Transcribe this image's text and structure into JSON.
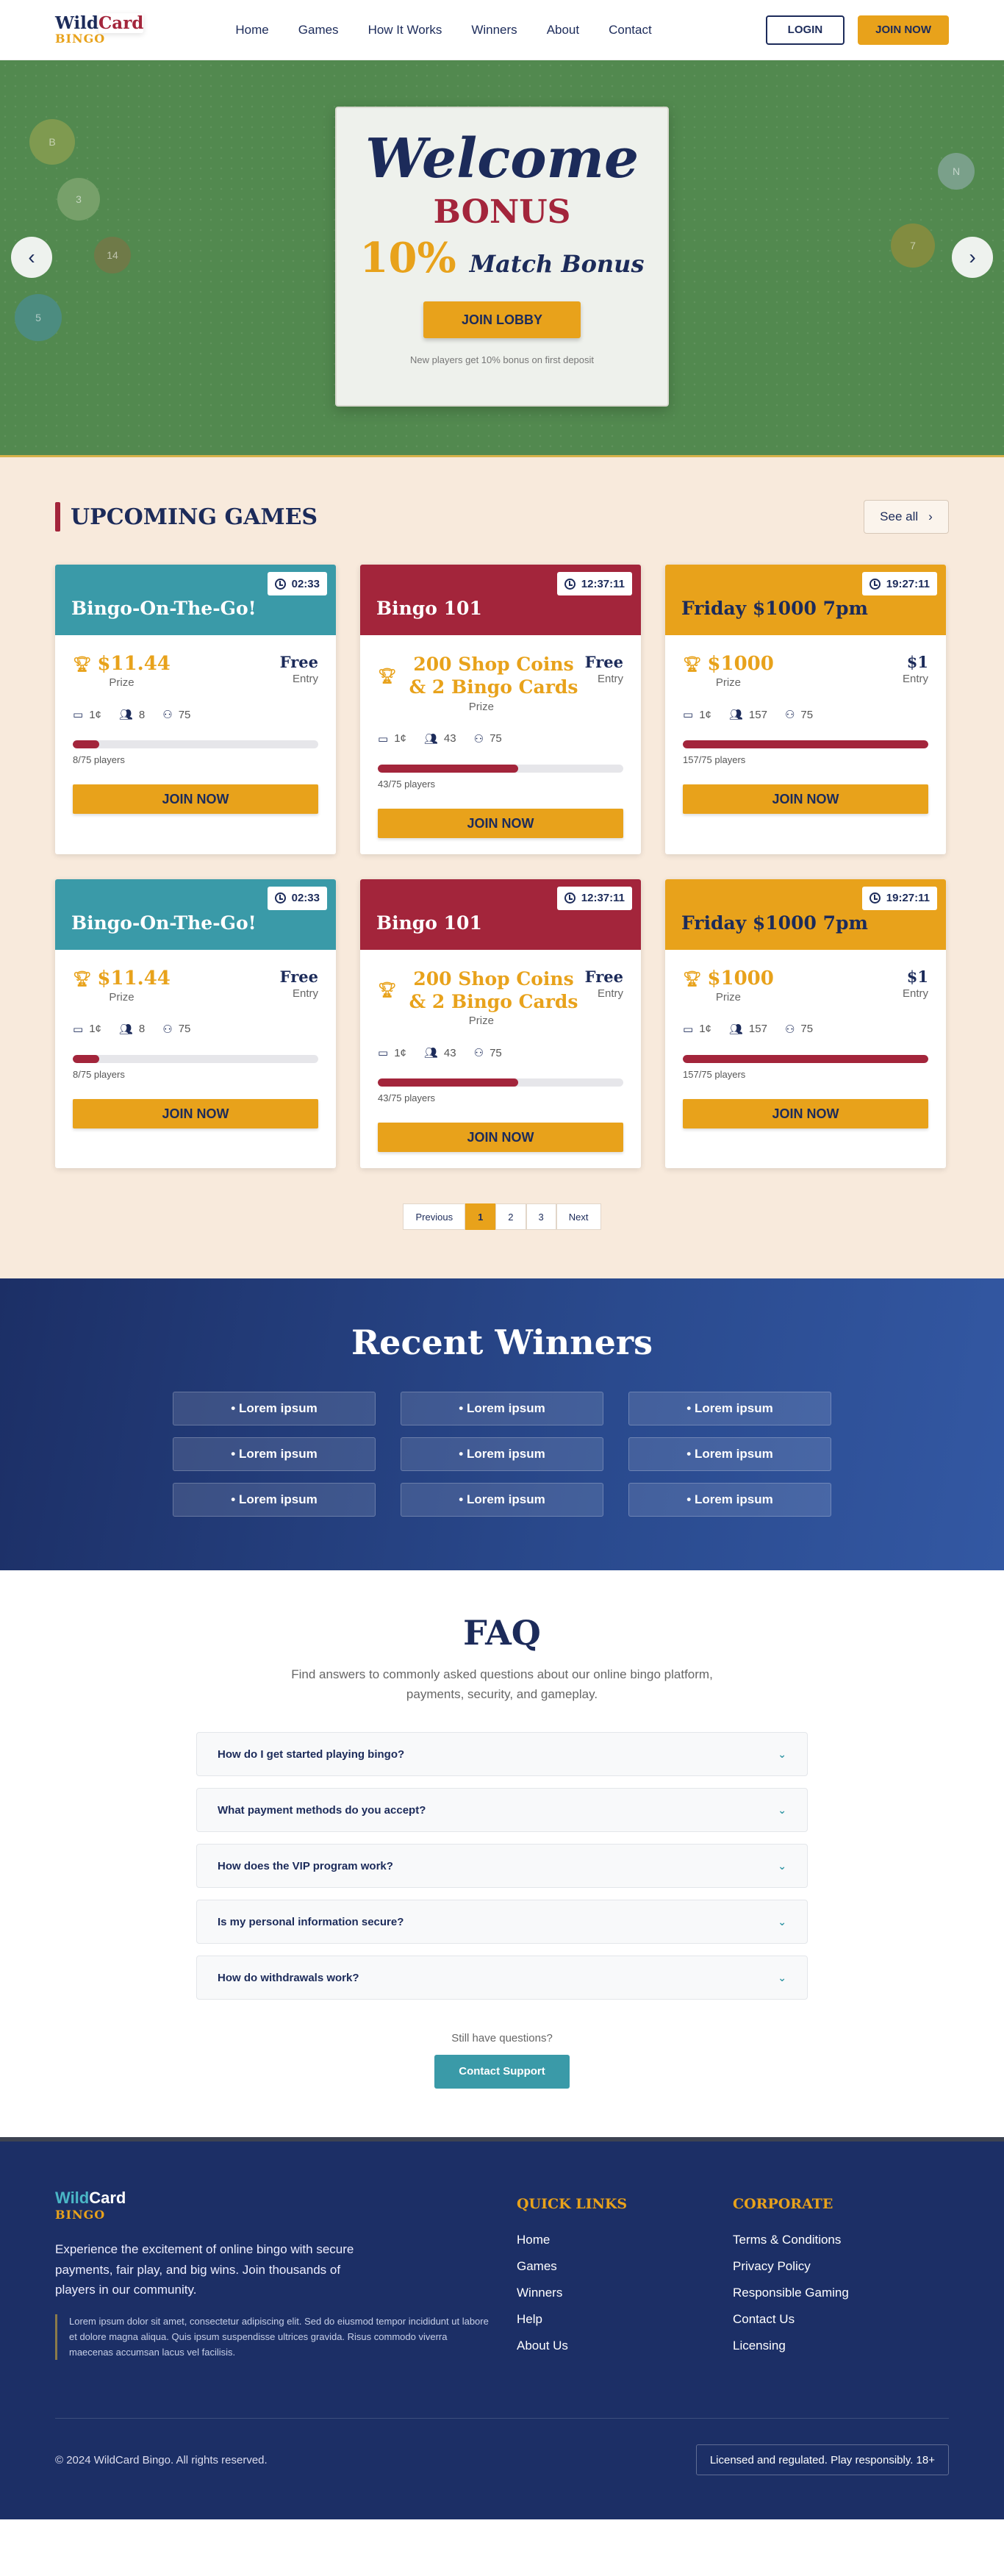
{
  "brand": {
    "line1a": "Wild",
    "line1b": "Card",
    "line2": "BINGO"
  },
  "nav": [
    "Home",
    "Games",
    "How It Works",
    "Winners",
    "About",
    "Contact"
  ],
  "header_buttons": {
    "login": "LOGIN",
    "join": "JOIN NOW"
  },
  "hero": {
    "welcome": "Welcome",
    "bonus": "BONUS",
    "percent": "10%",
    "match": "Match Bonus",
    "cta": "JOIN LOBBY",
    "note": "New players get 10% bonus on first deposit",
    "balls": [
      "B",
      "3",
      "14",
      "5",
      "N",
      "7"
    ],
    "prev_icon": "chevron-left-icon",
    "next_icon": "chevron-right-icon"
  },
  "upcoming": {
    "title": "UPCOMING GAMES",
    "see_all": "See all",
    "prize_label": "Prize",
    "entry_label": "Entry",
    "join_label": "JOIN NOW",
    "games": [
      {
        "title": "Bingo-On-The-Go!",
        "timer": "02:33",
        "color": "#3a9aa8",
        "prize": "$11.44",
        "entry": "Free",
        "card_price": "1¢",
        "players_now": "8",
        "max": "75",
        "players_text": "8/75 players",
        "progress": 0.107
      },
      {
        "title": "Bingo 101",
        "timer": "12:37:11",
        "color": "#a3253b",
        "prize": "200 Shop Coins & 2 Bingo Cards",
        "entry": "Free",
        "card_price": "1¢",
        "players_now": "43",
        "max": "75",
        "players_text": "43/75 players",
        "progress": 0.573
      },
      {
        "title": "Friday $1000 7pm",
        "timer": "19:27:11",
        "color": "#e8a21b",
        "prize": "$1000",
        "entry": "$1",
        "card_price": "1¢",
        "players_now": "157",
        "max": "75",
        "players_text": "157/75 players",
        "progress": 1.0
      },
      {
        "title": "Bingo-On-The-Go!",
        "timer": "02:33",
        "color": "#3a9aa8",
        "prize": "$11.44",
        "entry": "Free",
        "card_price": "1¢",
        "players_now": "8",
        "max": "75",
        "players_text": "8/75 players",
        "progress": 0.107
      },
      {
        "title": "Bingo 101",
        "timer": "12:37:11",
        "color": "#a3253b",
        "prize": "200 Shop Coins & 2 Bingo Cards",
        "entry": "Free",
        "card_price": "1¢",
        "players_now": "43",
        "max": "75",
        "players_text": "43/75 players",
        "progress": 0.573
      },
      {
        "title": "Friday $1000 7pm",
        "timer": "19:27:11",
        "color": "#e8a21b",
        "prize": "$1000",
        "entry": "$1",
        "card_price": "1¢",
        "players_now": "157",
        "max": "75",
        "players_text": "157/75 players",
        "progress": 1.0
      }
    ],
    "pagination": {
      "prev": "Previous",
      "pages": [
        "1",
        "2",
        "3"
      ],
      "active": "1",
      "next": "Next"
    }
  },
  "winners": {
    "title": "Recent Winners",
    "items": [
      "• Lorem ipsum",
      "• Lorem ipsum",
      "• Lorem ipsum",
      "• Lorem ipsum",
      "• Lorem ipsum",
      "• Lorem ipsum",
      "• Lorem ipsum",
      "• Lorem ipsum",
      "• Lorem ipsum"
    ]
  },
  "faq": {
    "title": "FAQ",
    "subtitle": "Find answers to commonly asked questions about our online bingo platform, payments, security, and gameplay.",
    "questions": [
      "How do I get started playing bingo?",
      "What payment methods do you accept?",
      "How does the VIP program work?",
      "Is my personal information secure?",
      "How do withdrawals work?"
    ],
    "still": "Still have questions?",
    "support": "Contact Support"
  },
  "footer": {
    "logo_a": "Wild",
    "logo_b": "Card",
    "logo_c": "BINGO",
    "description": "Experience the excitement of online bingo with secure payments, fair play, and big wins. Join thousands of players in our community.",
    "quote": "Lorem ipsum dolor sit amet, consectetur adipiscing elit. Sed do eiusmod tempor incididunt ut labore et dolore magna aliqua. Quis ipsum suspendisse ultrices gravida. Risus commodo viverra maecenas accumsan lacus vel facilisis.",
    "quick_title": "QUICK LINKS",
    "quick_links": [
      "Home",
      "Games",
      "Winners",
      "Help",
      "About Us"
    ],
    "corp_title": "CORPORATE",
    "corp_links": [
      "Terms & Conditions",
      "Privacy Policy",
      "Responsible Gaming",
      "Contact Us",
      "Licensing"
    ],
    "copyright": "© 2024 WildCard Bingo. All rights reserved.",
    "licensed": "Licensed and regulated. Play responsibly. 18+"
  }
}
